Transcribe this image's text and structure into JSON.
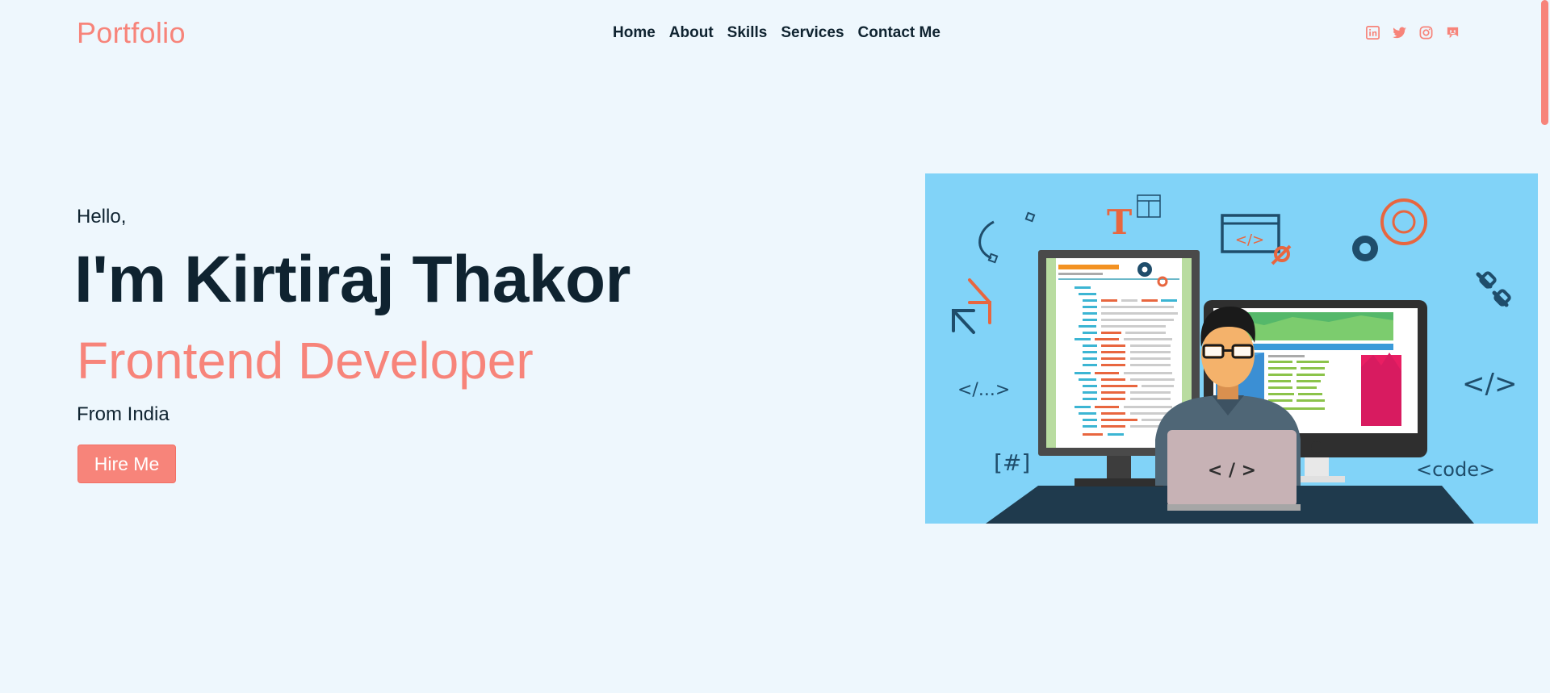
{
  "header": {
    "logo": "Portfolio",
    "nav": [
      "Home",
      "About",
      "Skills",
      "Services",
      "Contact Me"
    ],
    "social": [
      "linkedin-icon",
      "twitter-icon",
      "instagram-icon",
      "discord-icon"
    ]
  },
  "hero": {
    "greeting": "Hello,",
    "name": "I'm Kirtiraj Thakor",
    "role": "Frontend Developer",
    "location": "From India",
    "cta": "Hire Me"
  },
  "illustration": {
    "laptop_code": "< / >",
    "tag_ellipsis": "</...>",
    "tag_close": "</>",
    "tag_hash": "[#]",
    "tag_code": "<code>",
    "tag_small_code": "</>",
    "letter_t": "T"
  },
  "colors": {
    "accent": "#f7847a",
    "dark": "#0f2330",
    "background": "#eef7fd",
    "illustration_bg": "#81d3f8"
  }
}
